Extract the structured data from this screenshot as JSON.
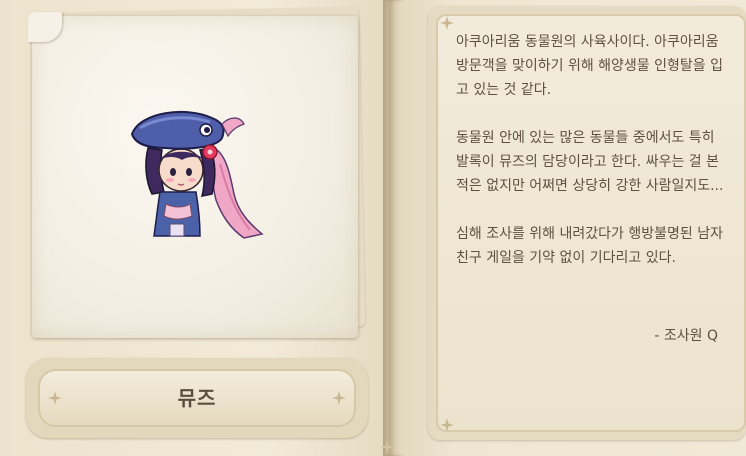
{
  "character": {
    "name": "뮤즈",
    "portrait_icon": "muse-character-sprite"
  },
  "description": {
    "paragraphs": [
      "아쿠아리움 동물원의 사육사이다. 아쿠아리움 방문객을 맞이하기 위해 해양생물 인형탈을 입고 있는 것 같다.",
      "동물원 안에 있는 많은 동물들 중에서도 특히 발록이 뮤즈의 담당이라고 한다. 싸우는 걸 본 적은 없지만 어쩌면 상당히 강한 사람일지도...",
      "심해 조사를 위해 내려갔다가 행방불명된 남자친구 게일을 기약 없이 기다리고 있다."
    ],
    "signature": "- 조사원 Q"
  },
  "colors": {
    "page": "#efe6d2",
    "text": "#5e5141",
    "sparkle": "#bfae8b"
  }
}
